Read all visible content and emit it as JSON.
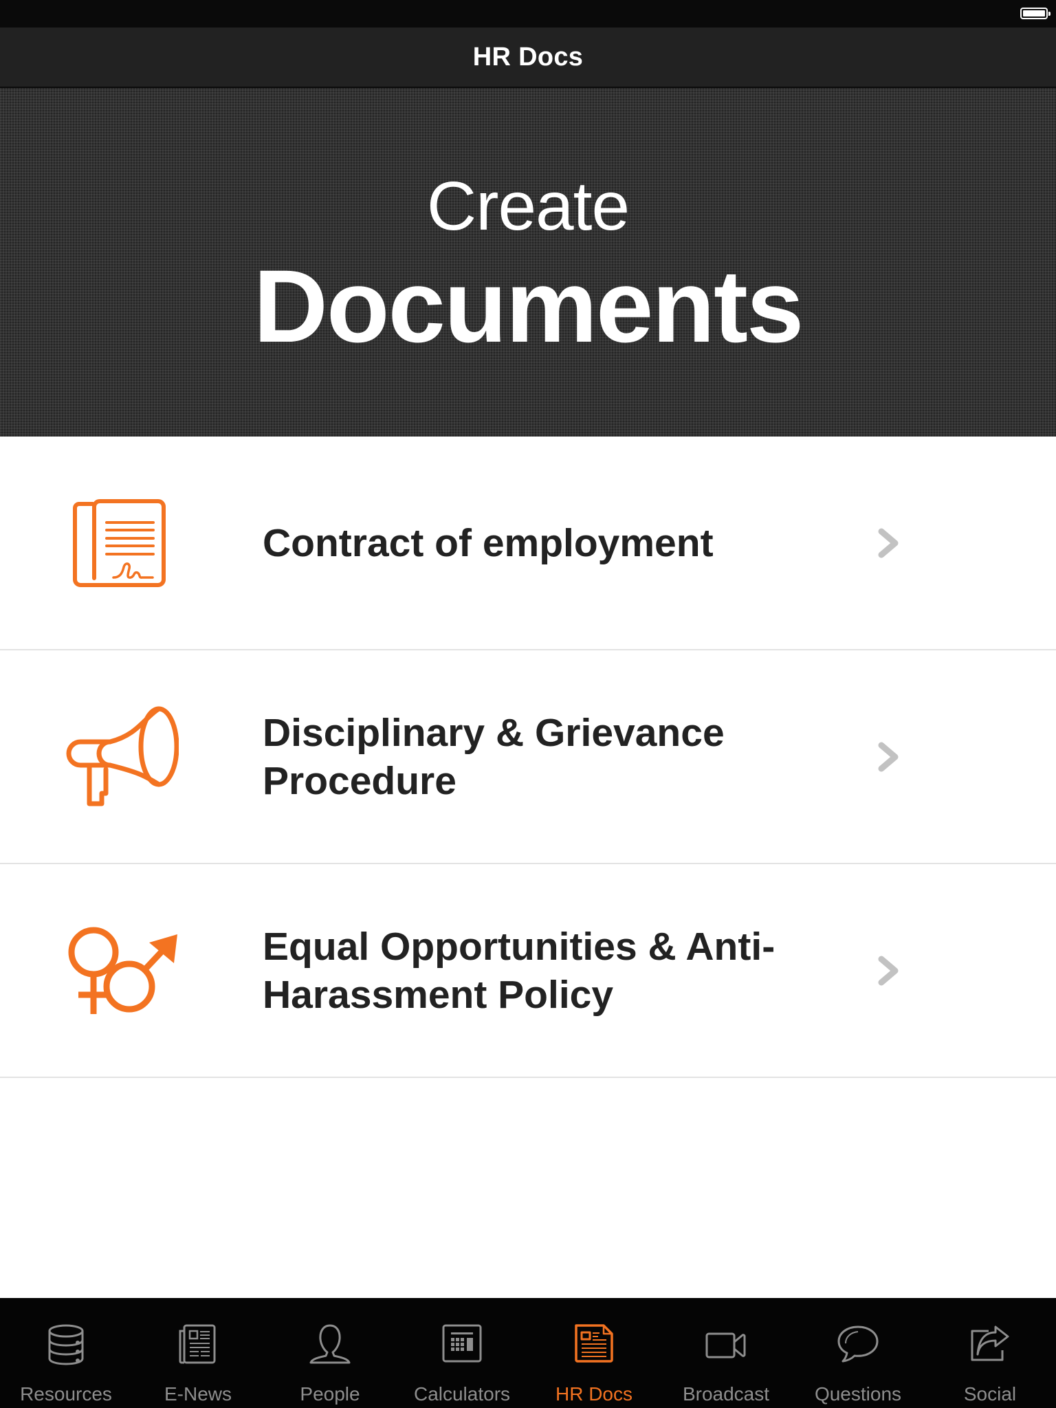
{
  "status_bar": {
    "battery_icon": "battery-full-icon"
  },
  "nav": {
    "title": "HR Docs"
  },
  "banner": {
    "line1": "Create",
    "line2": "Documents"
  },
  "colors": {
    "accent": "#f37321",
    "tab_inactive": "#8e8e8e",
    "chevron": "#c2c2c2"
  },
  "documents": [
    {
      "label": "Contract of employment",
      "icon": "contract-document-icon"
    },
    {
      "label": "Disciplinary & Grievance Procedure",
      "icon": "megaphone-icon"
    },
    {
      "label": "Equal Opportunities & Anti-Harassment Policy",
      "icon": "gender-symbols-icon"
    }
  ],
  "tabs": [
    {
      "label": "Resources",
      "icon": "database-icon",
      "active": false
    },
    {
      "label": "E-News",
      "icon": "newspaper-icon",
      "active": false
    },
    {
      "label": "People",
      "icon": "person-icon",
      "active": false
    },
    {
      "label": "Calculators",
      "icon": "calculator-icon",
      "active": false
    },
    {
      "label": "HR Docs",
      "icon": "hr-docs-icon",
      "active": true
    },
    {
      "label": "Broadcast",
      "icon": "video-camera-icon",
      "active": false
    },
    {
      "label": "Questions",
      "icon": "speech-bubble-icon",
      "active": false
    },
    {
      "label": "Social",
      "icon": "share-icon",
      "active": false
    }
  ]
}
